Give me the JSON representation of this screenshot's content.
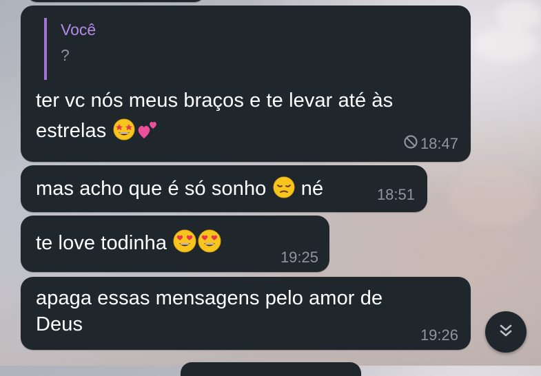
{
  "messages": [
    {
      "reply": {
        "name": "Você",
        "text": "?"
      },
      "line1": "ter vc nós meus braços e te levar até às",
      "line2": "estrelas",
      "emojis": [
        "star-struck-emoji",
        "two-hearts-emoji"
      ],
      "time": "18:47",
      "status_icon": "edited-block-icon"
    },
    {
      "text": "mas acho que é só sonho",
      "suffix": "né",
      "emojis": [
        "pensive-emoji"
      ],
      "time": "18:51"
    },
    {
      "text": "te love todinha",
      "emojis": [
        "heart-eyes-emoji",
        "heart-eyes-emoji"
      ],
      "time": "19:25"
    },
    {
      "line1": "apaga essas mensagens pelo amor de",
      "line2": "Deus",
      "time": "19:26"
    }
  ],
  "scroll_down_button": {
    "icon": "double-chevron-down-icon"
  },
  "colors": {
    "bubble": "#1f272d",
    "text": "#ffffff",
    "time": "#8d979f",
    "reply_accent": "#a472d6"
  }
}
